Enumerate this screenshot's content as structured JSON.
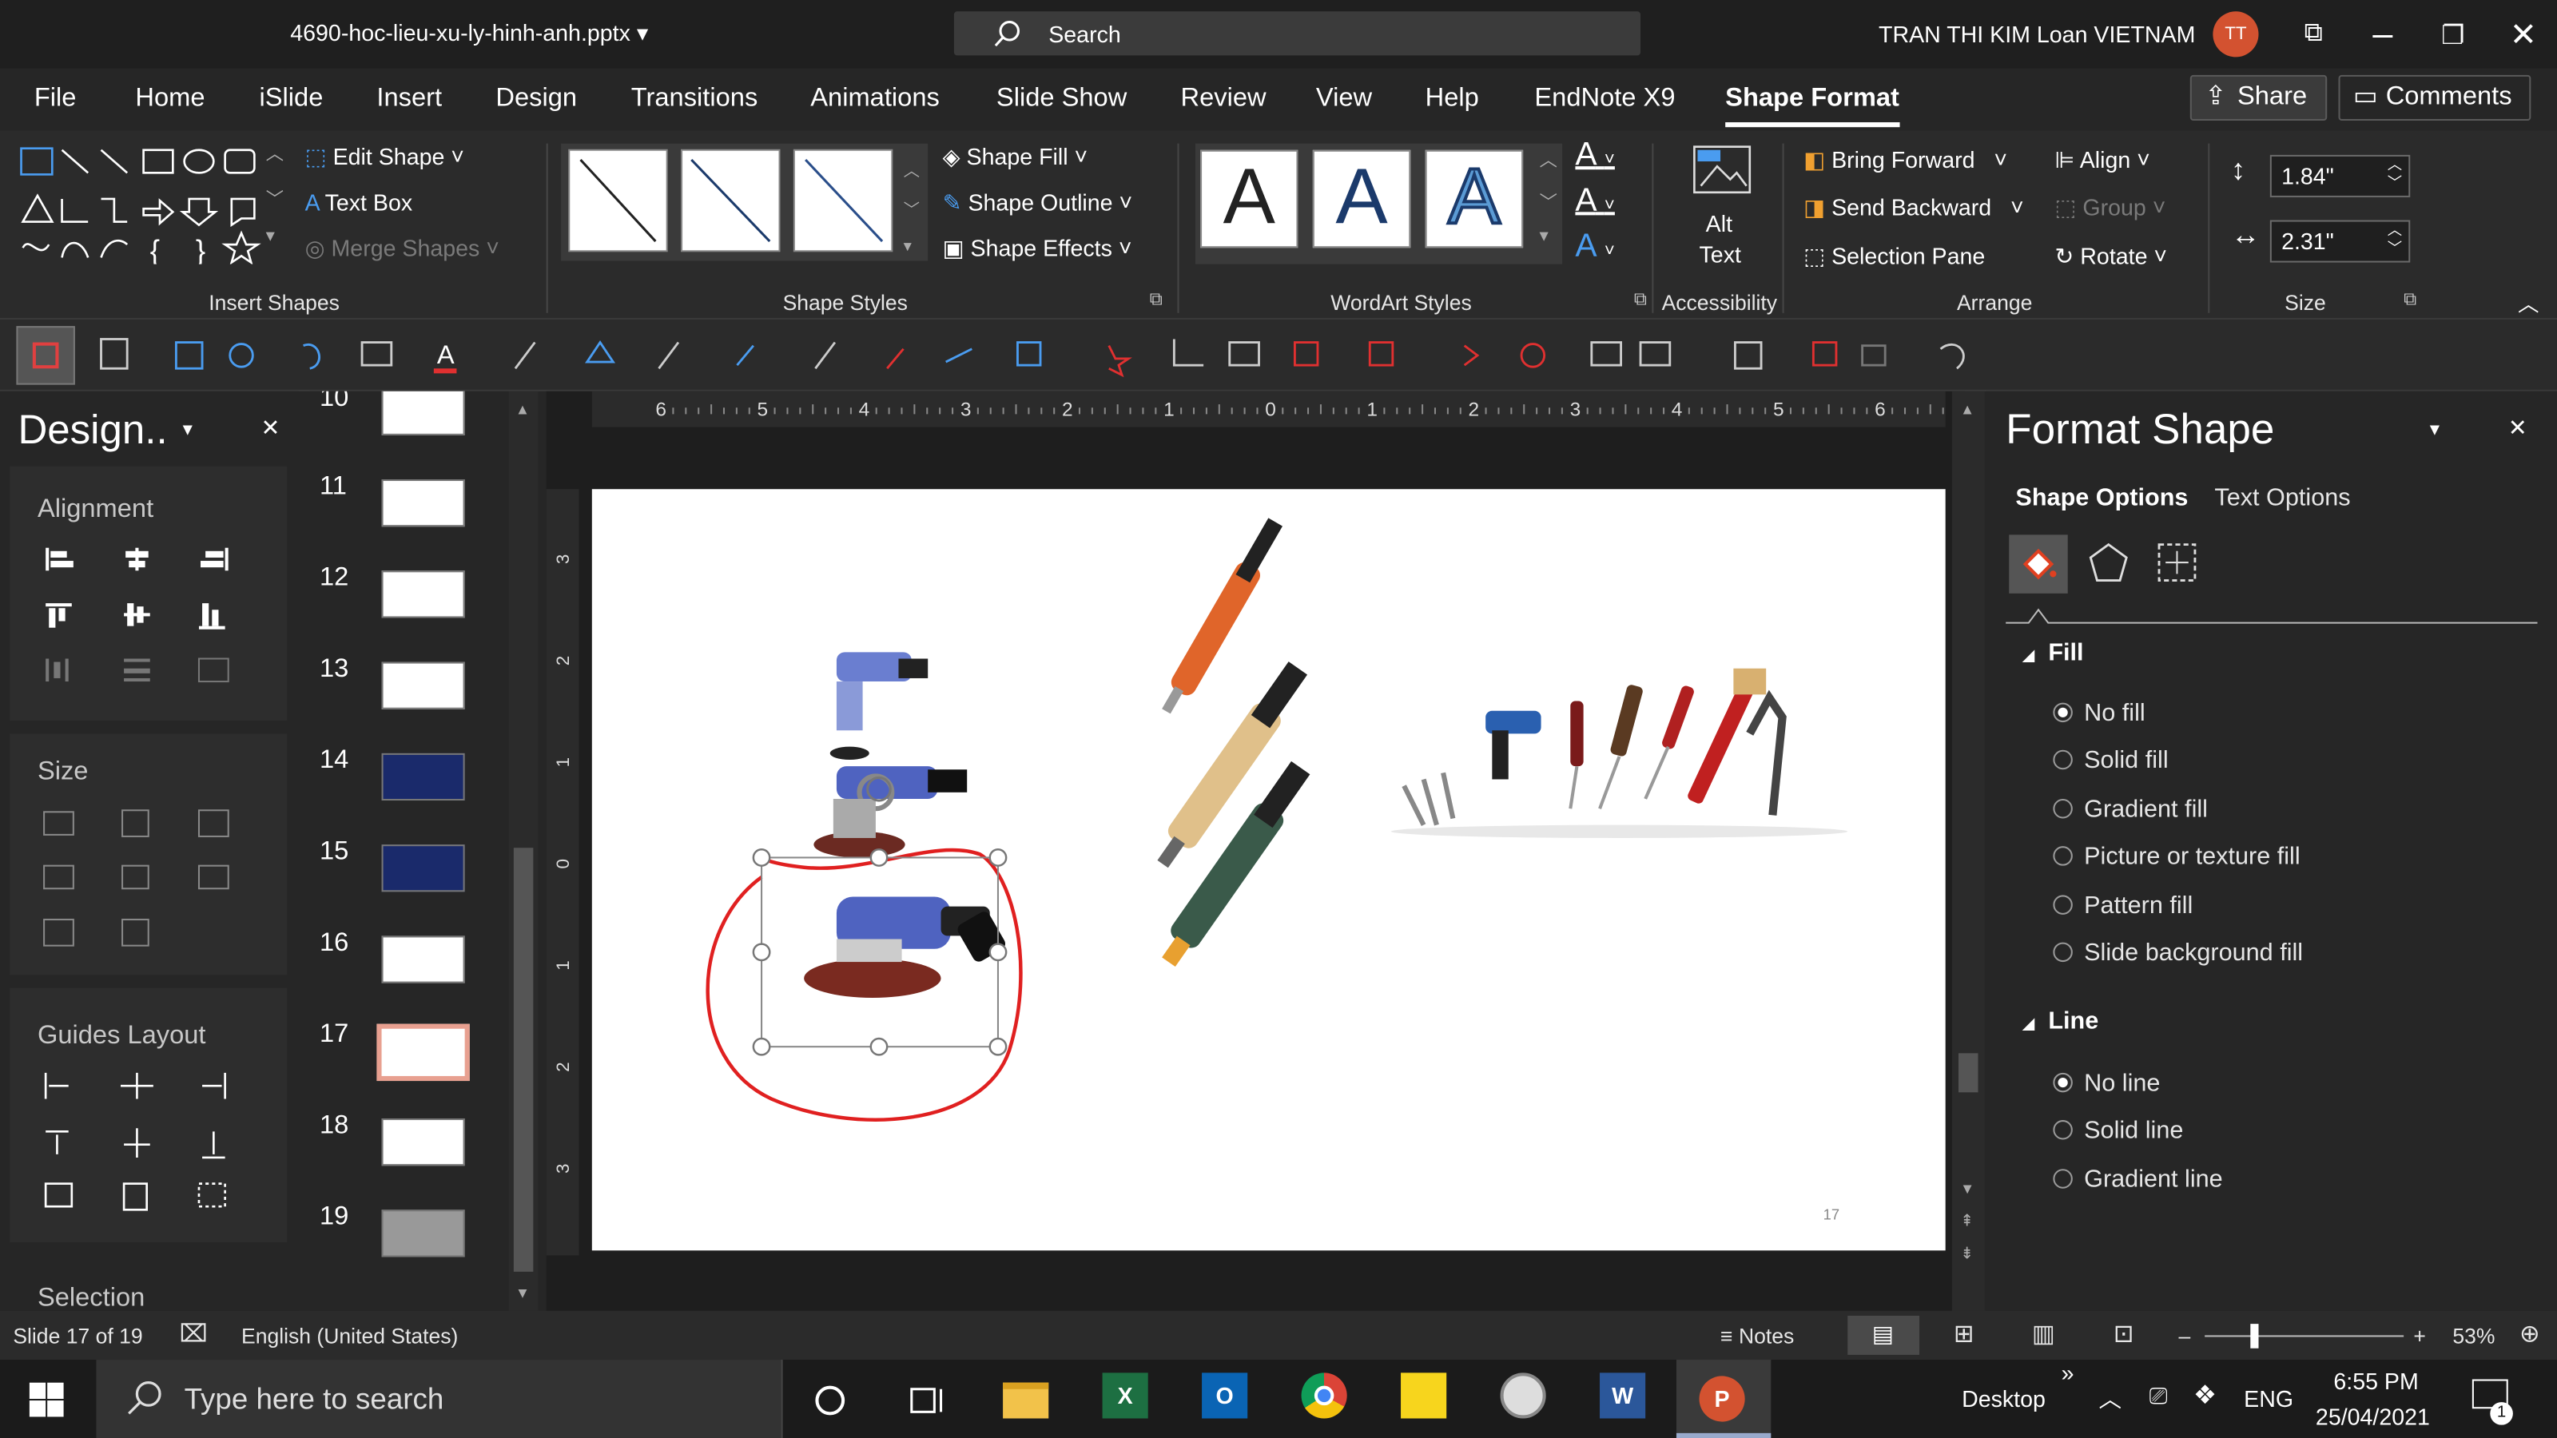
{
  "titlebar": {
    "filename": "4690-hoc-lieu-xu-ly-hinh-anh.pptx",
    "search": "Search",
    "user": "TRAN THI KIM Loan VIETNAM",
    "initials": "TT"
  },
  "tabs": [
    "File",
    "Home",
    "iSlide",
    "Insert",
    "Design",
    "Transitions",
    "Animations",
    "Slide Show",
    "Review",
    "View",
    "Help",
    "EndNote X9",
    "Shape Format"
  ],
  "active_tab": "Shape Format",
  "share": "Share",
  "comments": "Comments",
  "ribbon": {
    "edit_shape": "Edit Shape",
    "text_box": "Text Box",
    "merge_shapes": "Merge Shapes",
    "insert_shapes": "Insert Shapes",
    "shape_fill": "Shape Fill",
    "shape_outline": "Shape Outline",
    "shape_effects": "Shape Effects",
    "shape_styles": "Shape Styles",
    "wordart_glyph": "A",
    "wordart_styles": "WordArt Styles",
    "alt_text_1": "Alt",
    "alt_text_2": "Text",
    "accessibility": "Accessibility",
    "bring_forward": "Bring Forward",
    "send_backward": "Send Backward",
    "selection_pane": "Selection Pane",
    "align": "Align",
    "group": "Group",
    "rotate": "Rotate",
    "arrange": "Arrange",
    "height": "1.84\"",
    "width": "2.31\"",
    "size": "Size"
  },
  "design_pane": {
    "title": "Design..",
    "alignment": "Alignment",
    "size": "Size",
    "guides": "Guides Layout",
    "selection": "Selection"
  },
  "thumbnails": [
    {
      "n": "10"
    },
    {
      "n": "11"
    },
    {
      "n": "12"
    },
    {
      "n": "13"
    },
    {
      "n": "14"
    },
    {
      "n": "15"
    },
    {
      "n": "16"
    },
    {
      "n": "17"
    },
    {
      "n": "18"
    },
    {
      "n": "19"
    }
  ],
  "ruler": {
    "h": [
      "6",
      "5",
      "4",
      "3",
      "2",
      "1",
      "0",
      "1",
      "2",
      "3",
      "4",
      "5",
      "6"
    ],
    "v": [
      "3",
      "2",
      "1",
      "0",
      "1",
      "2",
      "3"
    ]
  },
  "slide": {
    "page_number": "17"
  },
  "format_pane": {
    "title": "Format Shape",
    "shape_options": "Shape Options",
    "text_options": "Text Options",
    "fill": "Fill",
    "fill_options": [
      "No fill",
      "Solid fill",
      "Gradient fill",
      "Picture or texture fill",
      "Pattern fill",
      "Slide background fill"
    ],
    "line": "Line",
    "line_options": [
      "No line",
      "Solid line",
      "Gradient line"
    ]
  },
  "status": {
    "slide": "Slide 17 of 19",
    "language": "English (United States)",
    "notes": "Notes",
    "zoom": "53%"
  },
  "taskbar": {
    "search": "Type here to search",
    "desktop": "Desktop",
    "lang": "ENG",
    "time": "6:55 PM",
    "date": "25/04/2021",
    "badge": "1"
  }
}
